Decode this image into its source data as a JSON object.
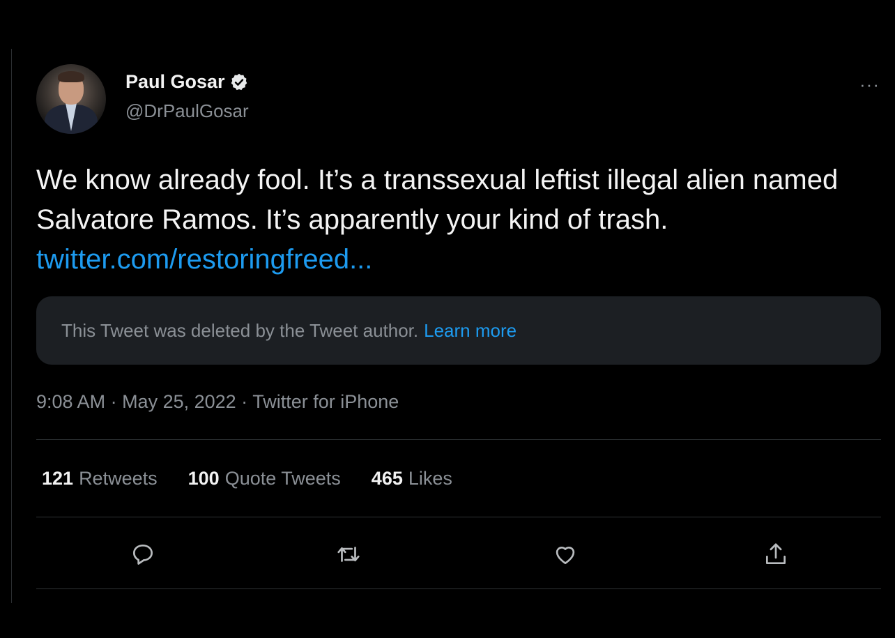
{
  "author": {
    "name": "Paul Gosar",
    "handle": "@DrPaulGosar",
    "avatar_icon": "profile-photo",
    "verified": true
  },
  "more_label": "···",
  "tweet": {
    "text": "We know already fool.  It’s a transsexual leftist illegal alien named Salvatore Ramos.  It’s apparently your kind of trash. ",
    "link": "twitter.com/restoringfreed..."
  },
  "quoted": {
    "deleted_text": "This Tweet was deleted by the Tweet author.",
    "learn_more": "Learn more"
  },
  "meta": {
    "time": "9:08 AM",
    "date": "May 25, 2022",
    "source": "Twitter for iPhone",
    "separator": " · "
  },
  "stats": [
    {
      "count": "121",
      "label": "Retweets"
    },
    {
      "count": "100",
      "label": "Quote Tweets"
    },
    {
      "count": "465",
      "label": "Likes"
    }
  ],
  "actions": [
    "reply-icon",
    "retweet-icon",
    "like-icon",
    "share-icon"
  ],
  "colors": {
    "background": "#000000",
    "text": "#e7e9ea",
    "muted": "#8b9096",
    "accent": "#1d9bf0",
    "card": "#1c1f23"
  }
}
